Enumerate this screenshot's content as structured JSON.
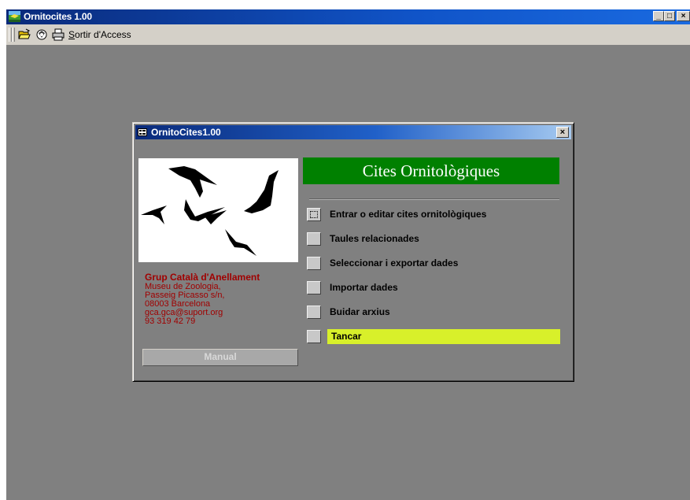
{
  "window": {
    "title": "Ornitocites 1.00",
    "caption_buttons": {
      "minimize": "_",
      "maximize": "□",
      "close": "×"
    }
  },
  "toolbar": {
    "icons": [
      "open-folder-icon",
      "save-icon",
      "print-icon"
    ],
    "exit_access_mnemonic": "S",
    "exit_access_rest": "ortir d'Access"
  },
  "dialog": {
    "title": "OrnitoCites1.00",
    "close_symbol": "×",
    "banner": "Cites Ornitològiques",
    "org": {
      "name": "Grup Català d'Anellament",
      "lines": [
        "Museu de Zoologia,",
        "Passeig Picasso s/n,",
        "08003 Barcelona",
        "gca.gca@suport.org",
        "93 319 42 79"
      ]
    },
    "manual_label": "Manual",
    "menu": [
      {
        "label": "Entrar o editar cites ornitològiques",
        "focused": true
      },
      {
        "label": "Taules relacionades"
      },
      {
        "label": "Seleccionar i exportar dades"
      },
      {
        "label": "Importar dades"
      },
      {
        "label": "Buidar arxius"
      },
      {
        "label": "Tancar",
        "highlighted": true
      }
    ]
  },
  "colors": {
    "titlebar": "#0a2a7a",
    "workspace": "#808080",
    "banner": "#008000",
    "org_text": "#a00000",
    "highlight": "#d8f02a"
  }
}
